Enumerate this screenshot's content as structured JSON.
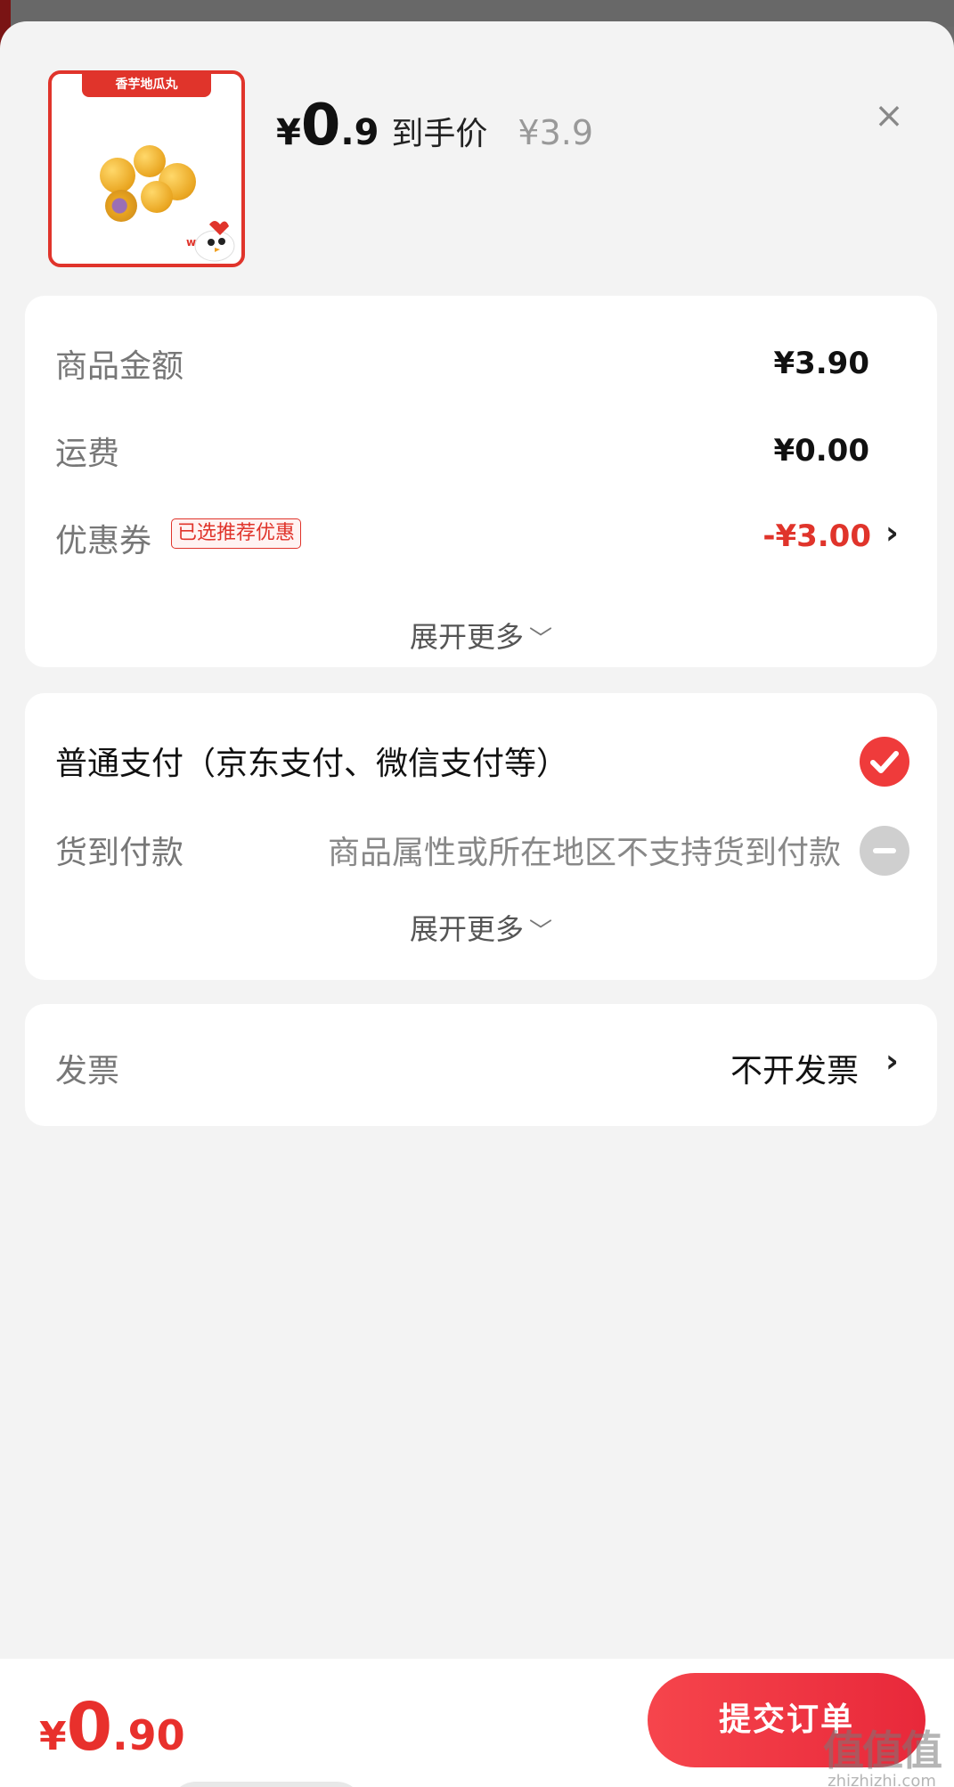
{
  "product": {
    "thumb_tag": "香芋地瓜丸",
    "price_yen": "¥",
    "price_int": "0",
    "price_dec": ".9",
    "price_label": "到手价",
    "original_price": "¥3.9"
  },
  "summary": {
    "goods_amount_label": "商品金额",
    "goods_amount_value": "¥3.90",
    "shipping_label": "运费",
    "shipping_value": "¥0.00",
    "coupon_label": "优惠券",
    "coupon_badge": "已选推荐优惠",
    "coupon_value": "-¥3.00",
    "expand_label": "展开更多"
  },
  "payment": {
    "normal_label": "普通支付（京东支付、微信支付等）",
    "cod_label": "货到付款",
    "cod_note": "商品属性或所在地区不支持货到付款",
    "expand_label": "展开更多"
  },
  "invoice": {
    "label": "发票",
    "value": "不开发票"
  },
  "footer": {
    "total_yen": "¥",
    "total_int": "0",
    "total_dec": ".90",
    "submit_label": "提交订单",
    "watermark_big": "值值值",
    "watermark_small": "zhizhizhi.com"
  },
  "colors": {
    "accent": "#e0342b",
    "check": "#ef3b3b",
    "background": "#f3f3f3"
  }
}
